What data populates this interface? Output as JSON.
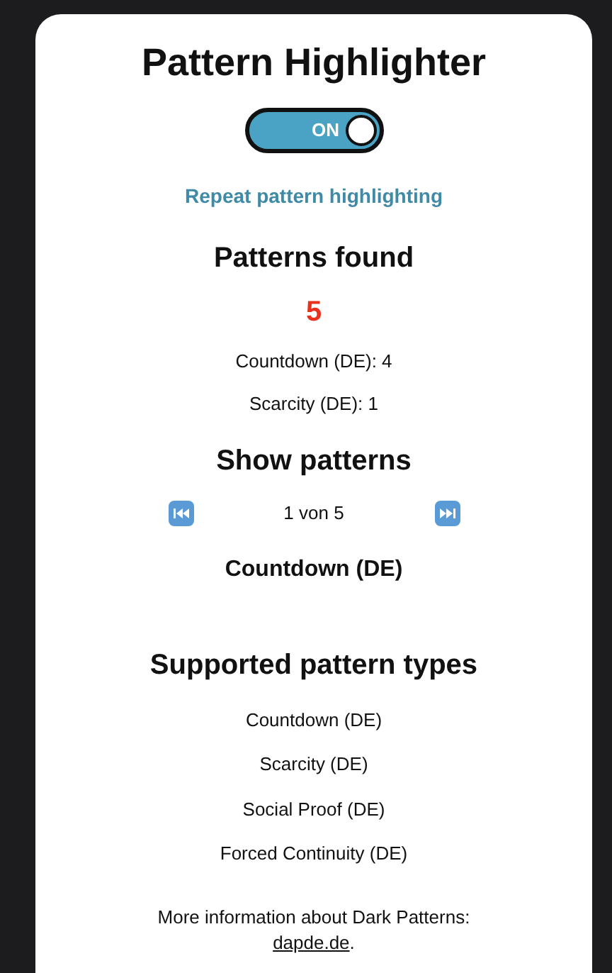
{
  "title": "Pattern Highlighter",
  "toggle": {
    "label": "ON",
    "on": true
  },
  "repeat_link": "Repeat pattern highlighting",
  "found": {
    "heading": "Patterns found",
    "count": "5",
    "items": [
      "Countdown (DE): 4",
      "Scarcity (DE): 1"
    ]
  },
  "show": {
    "heading": "Show patterns",
    "position": "1 von 5",
    "current": "Countdown (DE)"
  },
  "supported": {
    "heading": "Supported pattern types",
    "items": [
      "Countdown (DE)",
      "Scarcity (DE)",
      "Social Proof (DE)",
      "Forced Continuity (DE)"
    ]
  },
  "footer": {
    "text": "More information about Dark Patterns:",
    "link": "dapde.de",
    "suffix": "."
  }
}
